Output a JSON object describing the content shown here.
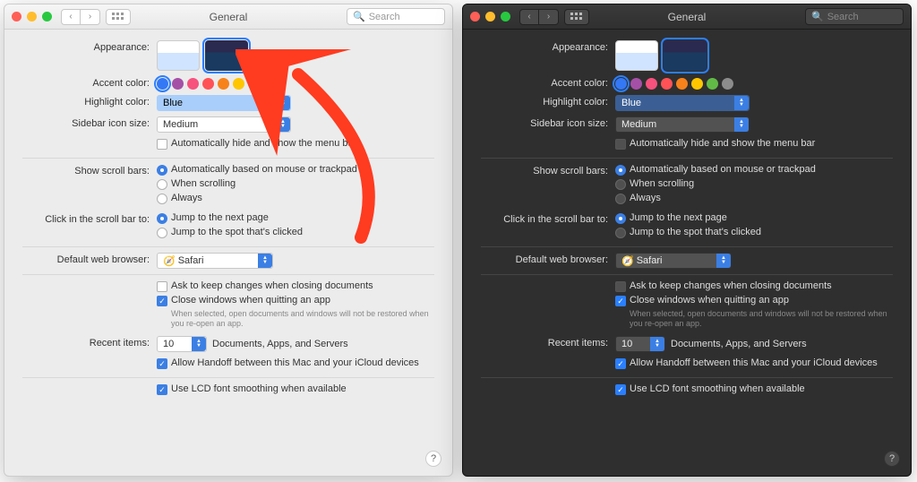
{
  "light": {
    "title": "General",
    "search_placeholder": "Search",
    "labels": {
      "appearance": "Appearance:",
      "accent": "Accent color:",
      "highlight": "Highlight color:",
      "sidebar": "Sidebar icon size:",
      "auto_hide": "Automatically hide and show the menu bar",
      "scroll": "Show scroll bars:",
      "scroll_auto": "Automatically based on mouse or trackpad",
      "scroll_when": "When scrolling",
      "scroll_always": "Always",
      "click_scroll": "Click in the scroll bar to:",
      "jump_next": "Jump to the next page",
      "jump_spot": "Jump to the spot that's clicked",
      "browser": "Default web browser:",
      "ask_keep": "Ask to keep changes when closing documents",
      "close_win": "Close windows when quitting an app",
      "close_help": "When selected, open documents and windows will not be restored when you re-open an app.",
      "recent": "Recent items:",
      "recent_suffix": "Documents, Apps, and Servers",
      "handoff": "Allow Handoff between this Mac and your iCloud devices",
      "lcd": "Use LCD font smoothing when available"
    },
    "values": {
      "highlight": "Blue",
      "sidebar": "Medium",
      "browser": "Safari",
      "recent": "10"
    },
    "accent_colors": [
      "#3478f6",
      "#a550a7",
      "#f7517e",
      "#ff5257",
      "#f7821b",
      "#ffc600",
      "#62ba46",
      "#8c8c8c"
    ]
  },
  "dark": {
    "title": "General",
    "search_placeholder": "Search",
    "labels": {
      "appearance": "Appearance:",
      "accent": "Accent color:",
      "highlight": "Highlight color:",
      "sidebar": "Sidebar icon size:",
      "auto_hide": "Automatically hide and show the menu bar",
      "scroll": "Show scroll bars:",
      "scroll_auto": "Automatically based on mouse or trackpad",
      "scroll_when": "When scrolling",
      "scroll_always": "Always",
      "click_scroll": "Click in the scroll bar to:",
      "jump_next": "Jump to the next page",
      "jump_spot": "Jump to the spot that's clicked",
      "browser": "Default web browser:",
      "ask_keep": "Ask to keep changes when closing documents",
      "close_win": "Close windows when quitting an app",
      "close_help": "When selected, open documents and windows will not be restored when you re-open an app.",
      "recent": "Recent items:",
      "recent_suffix": "Documents, Apps, and Servers",
      "handoff": "Allow Handoff between this Mac and your iCloud devices",
      "lcd": "Use LCD font smoothing when available"
    },
    "values": {
      "highlight": "Blue",
      "sidebar": "Medium",
      "browser": "Safari",
      "recent": "10"
    },
    "accent_colors": [
      "#3478f6",
      "#a550a7",
      "#f7517e",
      "#ff5257",
      "#f7821b",
      "#ffc600",
      "#62ba46",
      "#8c8c8c"
    ]
  }
}
